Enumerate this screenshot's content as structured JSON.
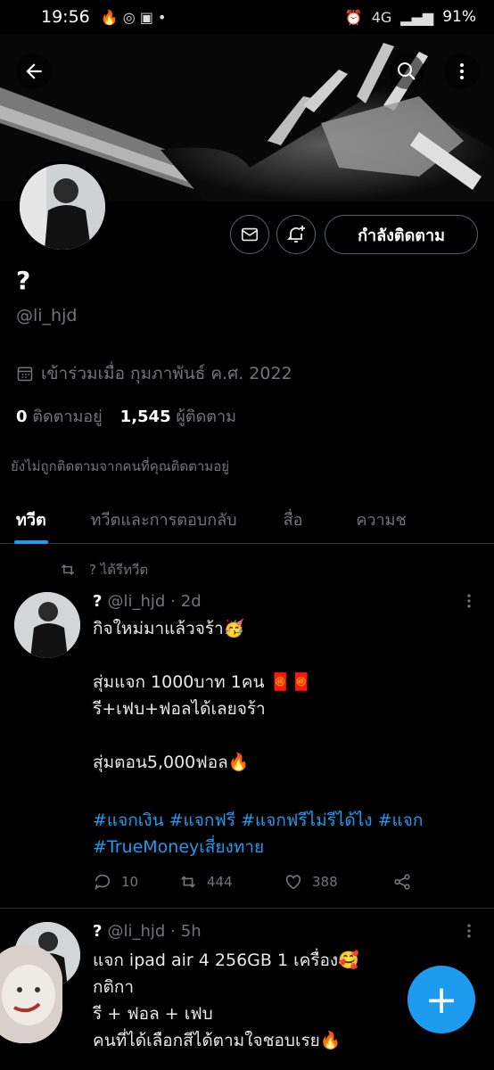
{
  "status": {
    "time": "19:56",
    "battery": "91%",
    "network": "4G"
  },
  "header": {
    "back_icon": "arrow-left-icon",
    "search_icon": "search-icon",
    "more_icon": "more-vertical-icon"
  },
  "profile": {
    "name": "?",
    "handle": "@li_hjd",
    "joined": "เข้าร่วมเมื่อ กุมภาพันธ์ ค.ศ. 2022",
    "following_count": "0",
    "following_label": "ติดตามอยู่",
    "followers_count": "1,545",
    "followers_label": "ผู้ติดตาม",
    "not_followed_note": "ยังไม่ถูกติดตามจากคนที่คุณติดตามอยู่",
    "follow_button_label": "กำลังติดตาม"
  },
  "tabs": [
    {
      "label": "ทวีต",
      "active": true
    },
    {
      "label": "ทวีตและการตอบกลับ",
      "active": false
    },
    {
      "label": "สื่อ",
      "active": false
    },
    {
      "label": "ความช",
      "active": false
    }
  ],
  "retweet_note": "? ได้รีทวีต",
  "tweets": [
    {
      "name": "?",
      "handle": "@li_hjd",
      "time": "· 2d",
      "text": "กิจใหม่มาแล้วจร้า🥳\n\nสุ่มแจก 1000บาท 1คน 🧧🧧\nรี+เฟบ+ฟอลได้เลยจร้า\n\nสุ่มตอน5,000ฟอล🔥",
      "hashtags": "#แจกเงิน #แจกฟรี #แจกฟรีไม่รีได้ไง #แจก #TrueMoneyเสี่ยงทาย",
      "replies": "10",
      "retweets": "444",
      "likes": "388"
    },
    {
      "name": "?",
      "handle": "@li_hjd",
      "time": "· 5h",
      "text": "แจก ipad air 4 256GB 1 เครื่อง🥰\nกติกา\n รี + ฟอล + เฟบ\nคนที่ได้เลือกสีได้ตามใจชอบเรย🔥"
    }
  ],
  "fab": {
    "label": "+",
    "icon": "compose-plus-icon"
  },
  "colors": {
    "accent": "#1d9bf0",
    "muted": "#71767b",
    "background": "#000000"
  }
}
